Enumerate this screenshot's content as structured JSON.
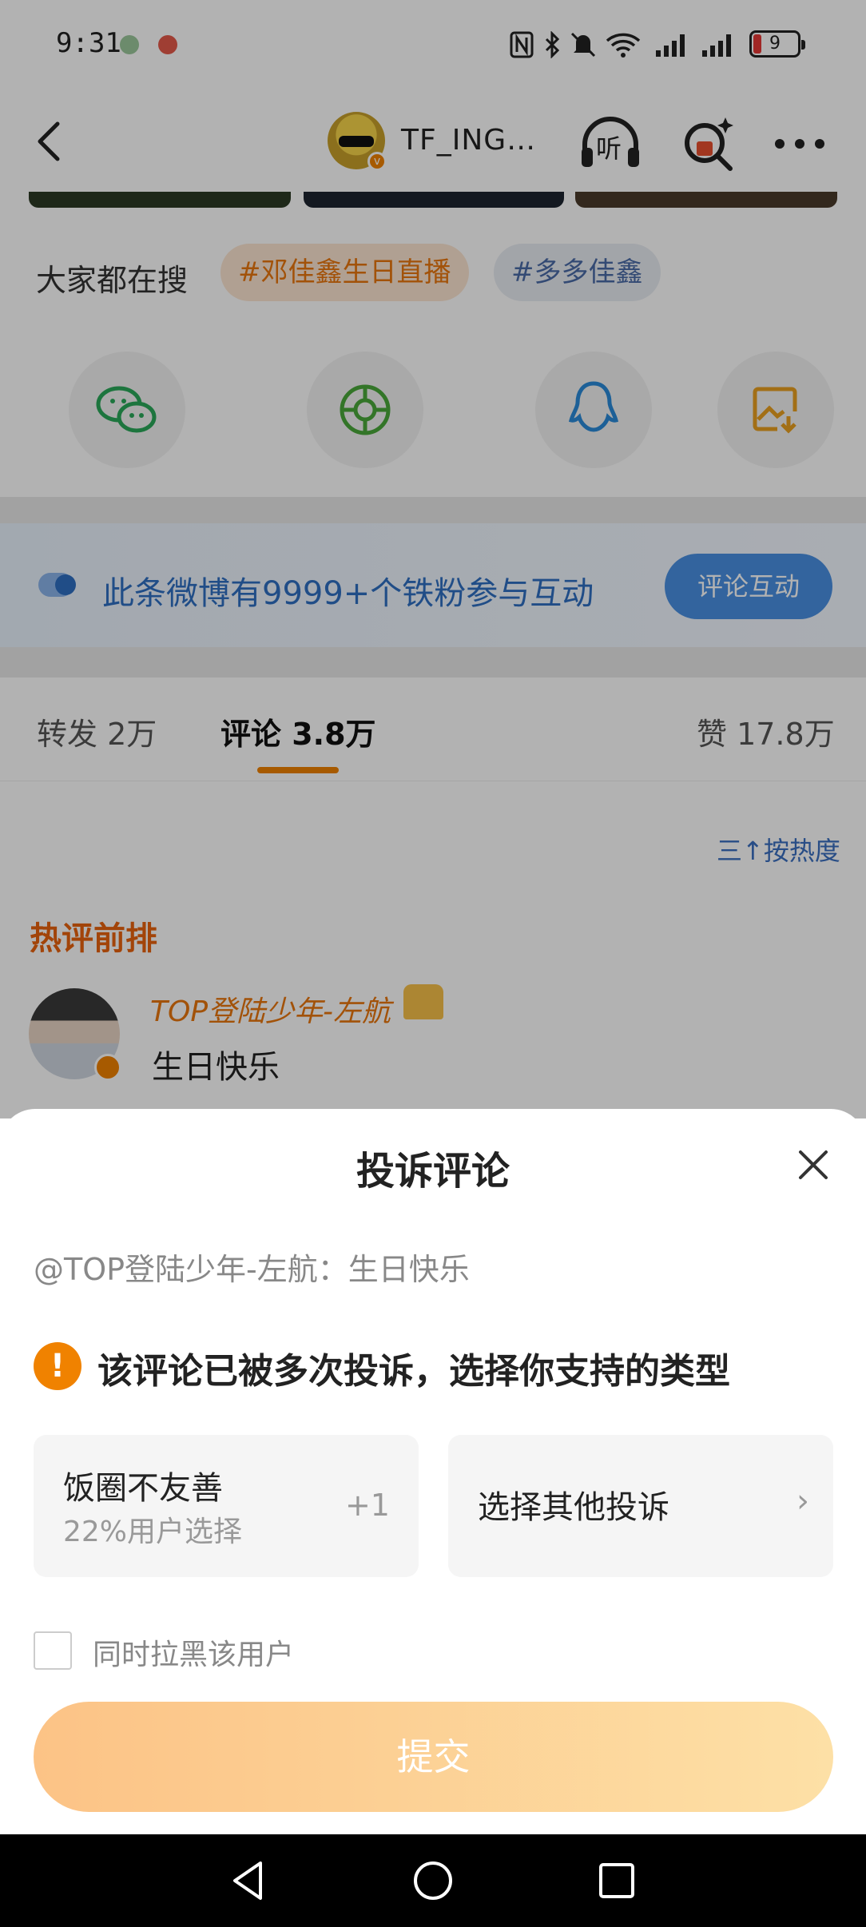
{
  "status_bar": {
    "time": "9:31",
    "battery": "9",
    "icons": [
      "nfc-icon",
      "bluetooth-icon",
      "mute-icon",
      "wifi-icon",
      "signal-icon",
      "signal-icon",
      "battery-icon"
    ]
  },
  "header": {
    "username": "TF_ING…",
    "listen_icon_label": "听",
    "icons": [
      "back-icon",
      "headphone-icon",
      "search-sparkle-icon",
      "more-icon"
    ]
  },
  "search": {
    "label": "大家都在搜",
    "chips": [
      "#邓佳鑫生日直播",
      "#多多佳鑫"
    ]
  },
  "share": {
    "icons": [
      "wechat-icon",
      "moments-icon",
      "qq-icon",
      "save-image-icon"
    ]
  },
  "banner": {
    "text": "此条微博有9999+个铁粉参与互动",
    "button": "评论互动"
  },
  "tabs": {
    "repost": "转发 2万",
    "comments": "评论 3.8万",
    "likes": "赞 17.8万"
  },
  "sort_label": "三↑按热度",
  "hot_title": "热评前排",
  "comment": {
    "name": "TOP登陆少年-左航",
    "text": "生日快乐"
  },
  "sheet": {
    "title": "投诉评论",
    "quote": "@TOP登陆少年-左航：生日快乐",
    "warning": "该评论已被多次投诉，选择你支持的类型",
    "option1": {
      "title": "饭圈不友善",
      "subtitle": "22%用户选择",
      "count": "+1"
    },
    "option2": {
      "title": "选择其他投诉",
      "chevron": "›"
    },
    "block_label": "同时拉黑该用户",
    "submit": "提交"
  },
  "colors": {
    "accent": "#f08200",
    "blue": "#4a90e2",
    "submit_start": "#fcc386",
    "submit_end": "#fde0a6"
  }
}
